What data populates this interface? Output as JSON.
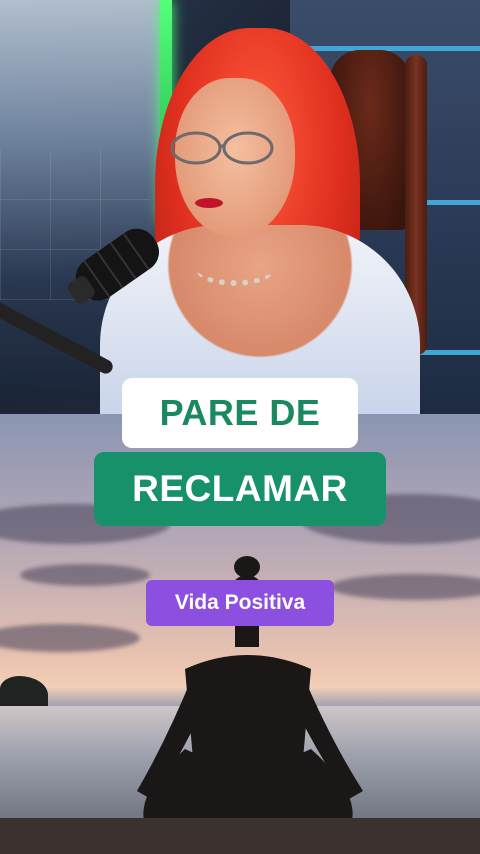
{
  "captions": {
    "line1": "PARE DE",
    "line2": "RECLAMAR"
  },
  "badge": {
    "label": "Vida Positiva"
  },
  "colors": {
    "caption_text_green": "#1a8a5e",
    "caption_bg_green": "#16916a",
    "badge_purple": "#8c4fe0",
    "hair_red": "#e0301f"
  },
  "images": {
    "top": "podcast-host-red-hair-microphone",
    "bottom": "woman-meditating-sunset-sea"
  }
}
